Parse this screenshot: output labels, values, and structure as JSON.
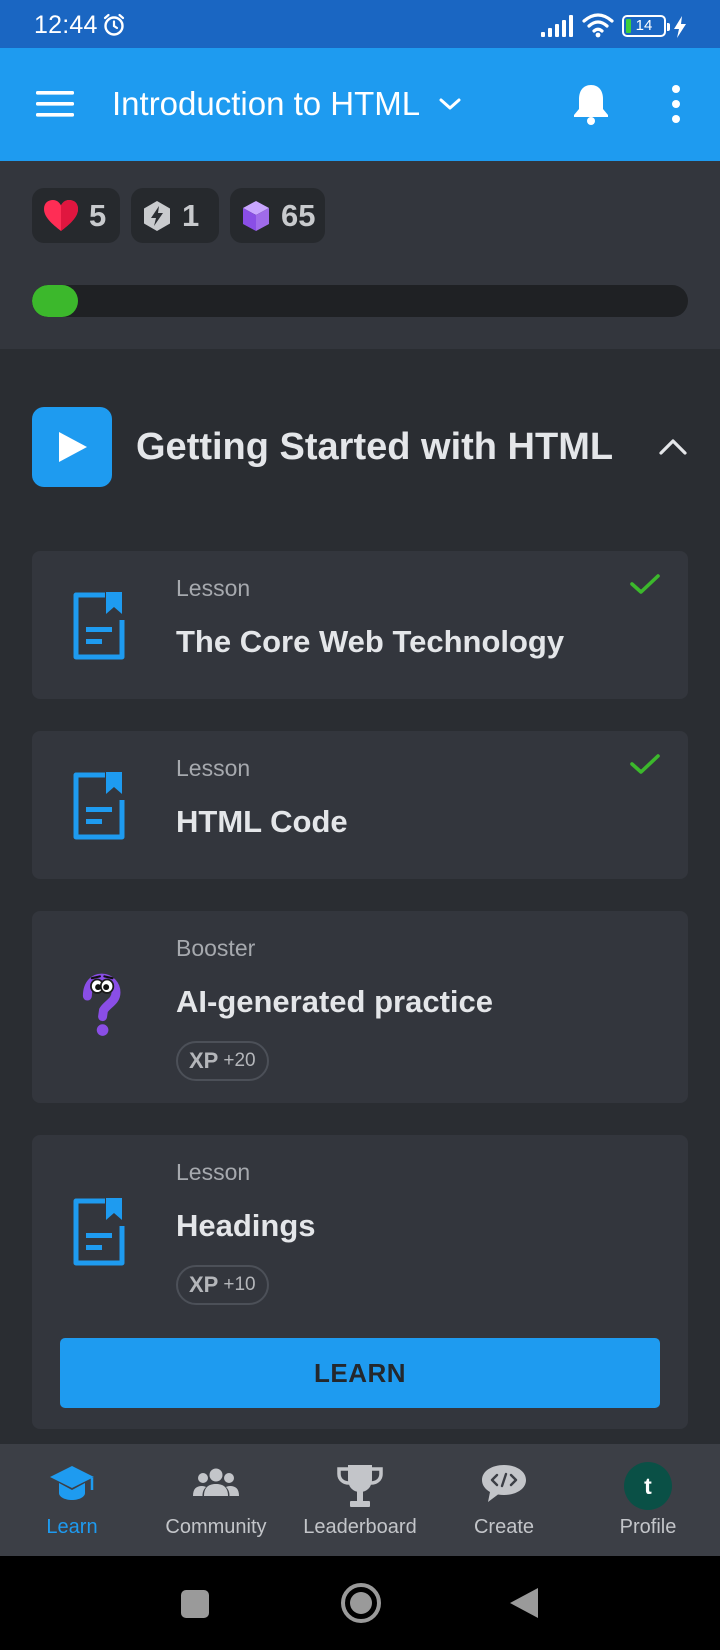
{
  "status_bar": {
    "time": "12:44",
    "battery": "14"
  },
  "app_bar": {
    "title": "Introduction to HTML"
  },
  "stats": {
    "hearts": "5",
    "streak": "1",
    "gems": "65",
    "progress_percent": 7
  },
  "module": {
    "title": "Getting Started with HTML"
  },
  "cards": [
    {
      "type": "Lesson",
      "title": "The Core Web Technology",
      "completed": true
    },
    {
      "type": "Lesson",
      "title": "HTML Code",
      "completed": true
    },
    {
      "type": "Booster",
      "title": "AI-generated practice",
      "xp_label": "XP",
      "xp_value": "+20"
    },
    {
      "type": "Lesson",
      "title": "Headings",
      "xp_label": "XP",
      "xp_value": "+10",
      "button_label": "LEARN"
    }
  ],
  "bottom_nav": [
    {
      "label": "Learn",
      "icon": "graduation-cap-icon",
      "active": true
    },
    {
      "label": "Community",
      "icon": "community-icon"
    },
    {
      "label": "Leaderboard",
      "icon": "trophy-icon"
    },
    {
      "label": "Create",
      "icon": "code-chat-icon"
    },
    {
      "label": "Profile",
      "icon": "avatar",
      "avatar_letter": "t"
    }
  ],
  "colors": {
    "brand_blue": "#1e9bf0",
    "status_bar": "#1a66c2",
    "progress_green": "#3cb82c",
    "check_green": "#3cb82c",
    "heart": "#ff2d55",
    "gem": "#a06bea"
  }
}
